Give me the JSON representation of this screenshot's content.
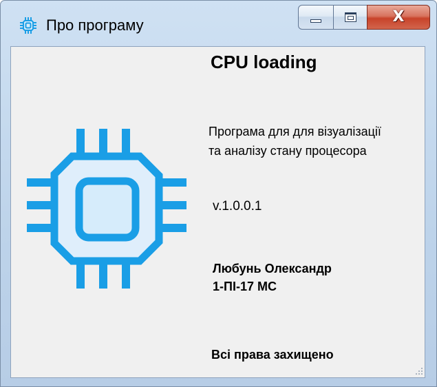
{
  "window": {
    "title": "Про програму",
    "icon": "cpu-chip-icon"
  },
  "controls": {
    "minimize_icon": "minimize-icon",
    "maximize_icon": "maximize-icon",
    "close_glyph": "X"
  },
  "about": {
    "app_name": "CPU loading",
    "description_line1": "Програма для для візуалізації",
    "description_line2": "та аналізу стану процесора",
    "version": "v.1.0.0.1",
    "author_line1": "Любунь Олександр",
    "author_line2": "1-ПІ-17 МС",
    "rights": "Всі права захищено",
    "logo_icon": "cpu-chip-icon"
  },
  "colors": {
    "accent": "#1a9ee6",
    "chip_fill": "#d6ecfb",
    "close_button": "#c8432a"
  }
}
